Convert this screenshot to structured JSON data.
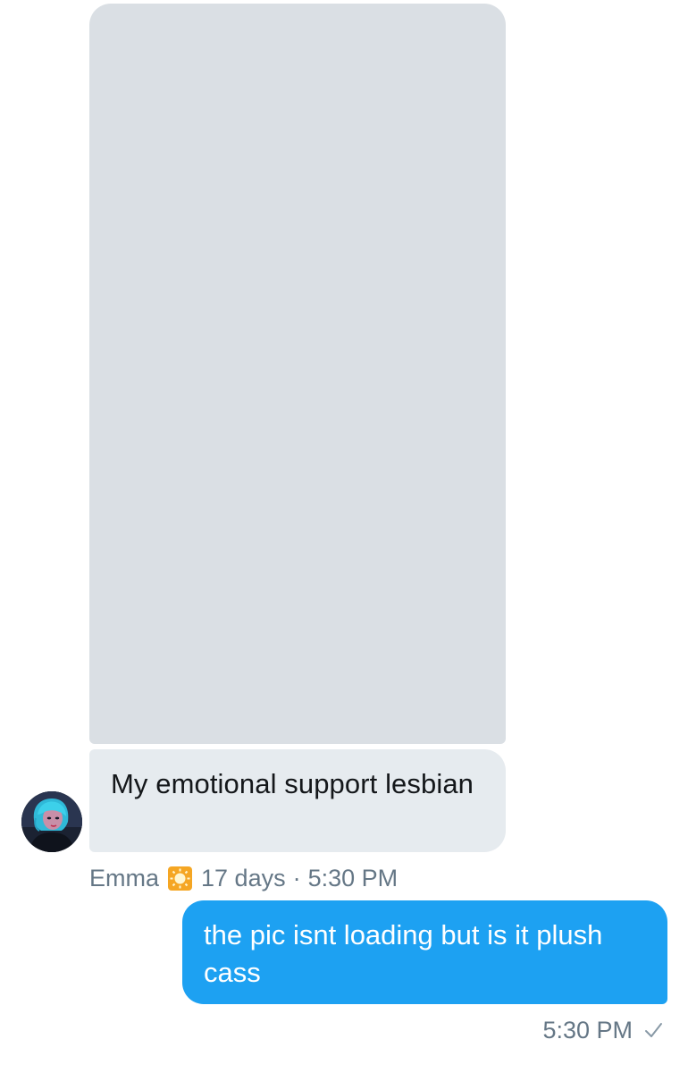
{
  "conversation": {
    "received": {
      "media_placeholder": "image-placeholder",
      "message": "My emotional support lesbian",
      "sender_name": "Emma",
      "sender_badge_icon": "sun-emoji-icon",
      "age": "17 days",
      "separator": "·",
      "time": "5:30 PM"
    },
    "sent": {
      "message": "the pic isnt loading but is it plush cass",
      "time": "5:30 PM",
      "status_icon": "check-icon"
    }
  },
  "colors": {
    "sent_bubble": "#1da1f2",
    "received_bubble": "#e6ebef",
    "media_placeholder": "#dadfe4",
    "meta_text": "#657786"
  }
}
